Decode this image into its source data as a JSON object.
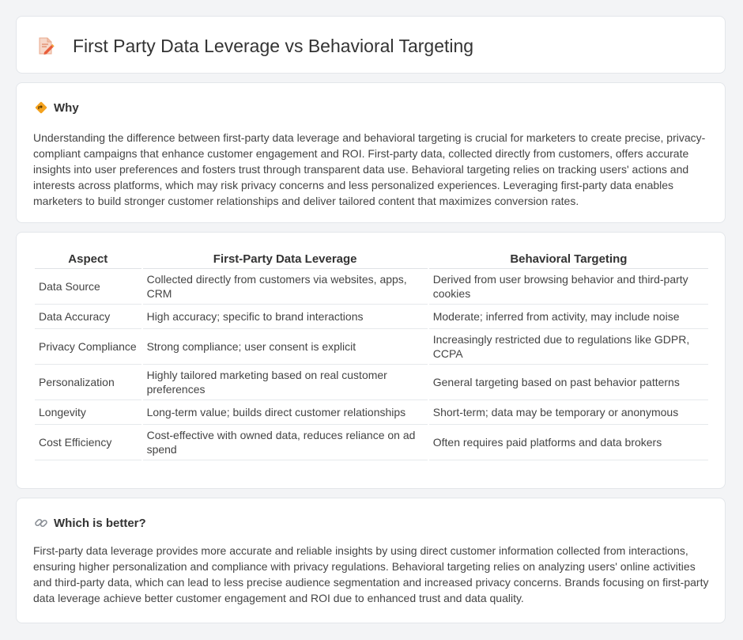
{
  "header": {
    "title": "First Party Data Leverage vs Behavioral Targeting",
    "icon": "document-pencil-icon"
  },
  "why": {
    "title": "Why",
    "icon": "diamond-road-sign-icon",
    "text": "Understanding the difference between first-party data leverage and behavioral targeting is crucial for marketers to create precise, privacy-compliant campaigns that enhance customer engagement and ROI. First-party data, collected directly from customers, offers accurate insights into user preferences and fosters trust through transparent data use. Behavioral targeting relies on tracking users' actions and interests across platforms, which may risk privacy concerns and less personalized experiences. Leveraging first-party data enables marketers to build stronger customer relationships and deliver tailored content that maximizes conversion rates."
  },
  "table": {
    "headers": [
      "Aspect",
      "First-Party Data Leverage",
      "Behavioral Targeting"
    ],
    "rows": [
      [
        "Data Source",
        "Collected directly from customers via websites, apps, CRM",
        "Derived from user browsing behavior and third-party cookies"
      ],
      [
        "Data Accuracy",
        "High accuracy; specific to brand interactions",
        "Moderate; inferred from activity, may include noise"
      ],
      [
        "Privacy Compliance",
        "Strong compliance; user consent is explicit",
        "Increasingly restricted due to regulations like GDPR, CCPA"
      ],
      [
        "Personalization",
        "Highly tailored marketing based on real customer preferences",
        "General targeting based on past behavior patterns"
      ],
      [
        "Longevity",
        "Long-term value; builds direct customer relationships",
        "Short-term; data may be temporary or anonymous"
      ],
      [
        "Cost Efficiency",
        "Cost-effective with owned data, reduces reliance on ad spend",
        "Often requires paid platforms and data brokers"
      ]
    ]
  },
  "better": {
    "title": "Which is better?",
    "icon": "link-icon",
    "text": "First-party data leverage provides more accurate and reliable insights by using direct customer information collected from interactions, ensuring higher personalization and compliance with privacy regulations. Behavioral targeting relies on analyzing users' online activities and third-party data, which can lead to less precise audience segmentation and increased privacy concerns. Brands focusing on first-party data leverage achieve better customer engagement and ROI due to enhanced trust and data quality."
  }
}
